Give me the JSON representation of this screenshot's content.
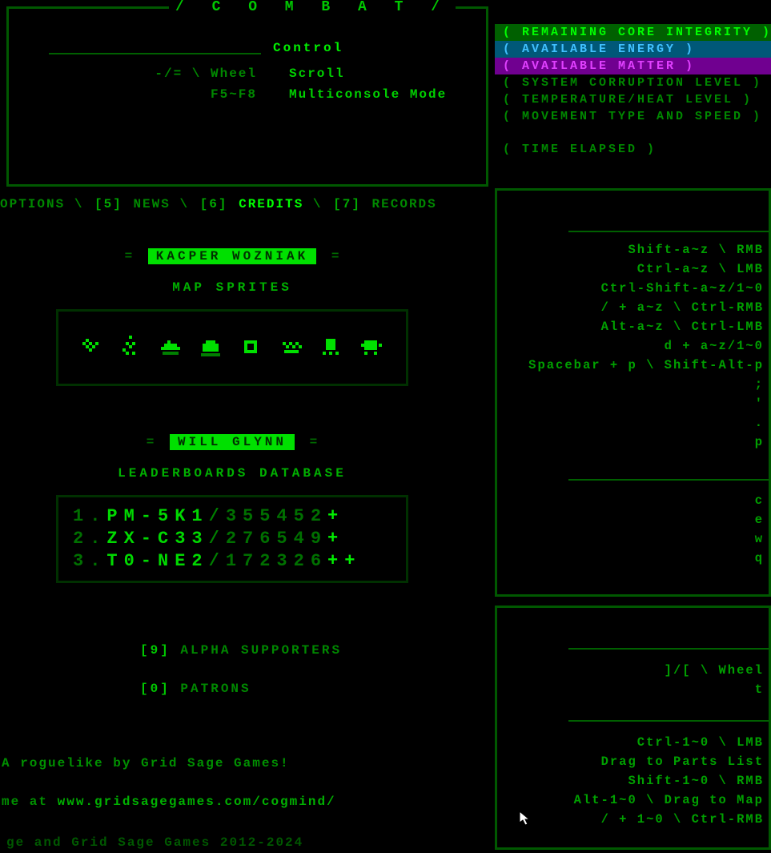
{
  "combat": {
    "title": "/ C O M B A T /",
    "section": "Control",
    "rows": [
      {
        "key": "-/= \\ Wheel",
        "val": "Scroll"
      },
      {
        "key": "F5~F8",
        "val": "Multiconsole Mode"
      }
    ]
  },
  "hud": {
    "integrity": "( REMAINING CORE INTEGRITY )",
    "energy": "( AVAILABLE ENERGY )",
    "matter": "( AVAILABLE MATTER )",
    "corruption": "( SYSTEM CORRUPTION LEVEL )",
    "temperature": "( TEMPERATURE/HEAT LEVEL )",
    "movement": "( MOVEMENT TYPE AND SPEED )",
    "time": "( TIME ELAPSED )"
  },
  "tabs": {
    "options": "OPTIONS",
    "news_num": "[5]",
    "news": "NEWS",
    "credits_num": "[6]",
    "credits": "CREDITS",
    "records_num": "[7]",
    "records": "RECORDS"
  },
  "credits": {
    "person1_name": "KACPER WOZNIAK",
    "person1_role": "MAP SPRITES",
    "person2_name": "WILL GLYNN",
    "person2_role": "LEADERBOARDS DATABASE",
    "leaderboard": [
      {
        "rank": "1.",
        "name": "PM-5K1",
        "score": "355452",
        "plus": "+"
      },
      {
        "rank": "2.",
        "name": "ZX-C33",
        "score": "276549",
        "plus": "+"
      },
      {
        "rank": "3.",
        "name": "T0-NE2",
        "score": "172326",
        "plus": "++"
      }
    ],
    "alpha_num": "[9]",
    "alpha": "ALPHA SUPPORTERS",
    "patrons_num": "[0]",
    "patrons": "PATRONS"
  },
  "footer": {
    "tagline": "A roguelike by Grid Sage Games!",
    "url_prefix": "me at ",
    "url": "www.gridsagegames.com/cogmind/",
    "copyright": "ge and Grid Sage Games 2012-2024"
  },
  "right1": {
    "lines": [
      "Shift-a~z \\ RMB",
      "Ctrl-a~z \\ LMB",
      "Ctrl-Shift-a~z/1~0",
      "/ + a~z \\ Ctrl-RMB",
      "Alt-a~z \\ Ctrl-LMB",
      "d + a~z/1~0",
      "Spacebar + p \\ Shift-Alt-p",
      ";",
      "'",
      ".",
      "p"
    ],
    "bottom": [
      "c",
      "e",
      "w",
      "q"
    ]
  },
  "right2": {
    "top": [
      "]/[ \\ Wheel",
      "t"
    ],
    "bottom": [
      "Ctrl-1~0 \\ LMB",
      "Drag to Parts List",
      "Shift-1~0 \\ RMB",
      "Alt-1~0 \\ Drag to Map",
      "/ + 1~0 \\ Ctrl-RMB"
    ]
  }
}
